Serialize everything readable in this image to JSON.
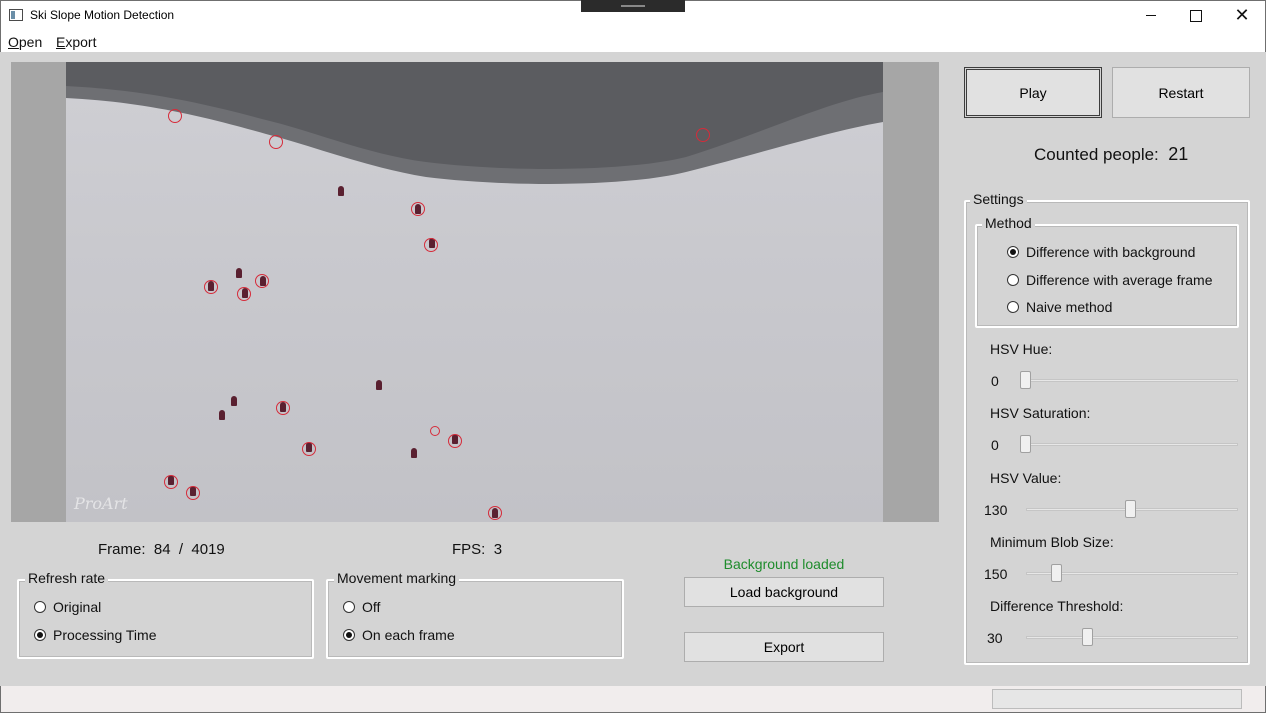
{
  "window": {
    "title": "Ski Slope Motion Detection",
    "minimize_glyph": "",
    "maximize_glyph": "",
    "close_glyph": "✕"
  },
  "menu": {
    "open": "Open",
    "export": "Export"
  },
  "video": {
    "watermark": "ProArt"
  },
  "frame_info": {
    "label": "Frame:",
    "current": "84",
    "separator": "/",
    "total": "4019"
  },
  "fps": {
    "label": "FPS:",
    "value": "3"
  },
  "refresh_rate": {
    "title": "Refresh rate",
    "options": [
      "Original",
      "Processing Time"
    ],
    "selected": 1
  },
  "movement_marking": {
    "title": "Movement marking",
    "options": [
      "Off",
      "On each frame"
    ],
    "selected": 1
  },
  "background": {
    "status": "Background loaded",
    "load_button": "Load background",
    "export_button": "Export",
    "status_color": "#1e8c2c"
  },
  "controls": {
    "play": "Play",
    "restart": "Restart"
  },
  "counter": {
    "label": "Counted people:",
    "value": "21"
  },
  "settings": {
    "title": "Settings",
    "method": {
      "title": "Method",
      "options": [
        "Difference with background",
        "Difference with average frame",
        "Naive method"
      ],
      "selected": 0
    },
    "sliders": [
      {
        "label": "HSV Hue:",
        "value": "0",
        "fraction": 0.0
      },
      {
        "label": "HSV Saturation:",
        "value": "0",
        "fraction": 0.0
      },
      {
        "label": "HSV Value:",
        "value": "130",
        "fraction": 0.51
      },
      {
        "label": "Minimum Blob Size:",
        "value": "150",
        "fraction": 0.15
      },
      {
        "label": "Difference Threshold:",
        "value": "30",
        "fraction": 0.3
      }
    ]
  },
  "colors": {
    "marker": "#d62b3a",
    "window_bg": "#d4d4d4"
  }
}
